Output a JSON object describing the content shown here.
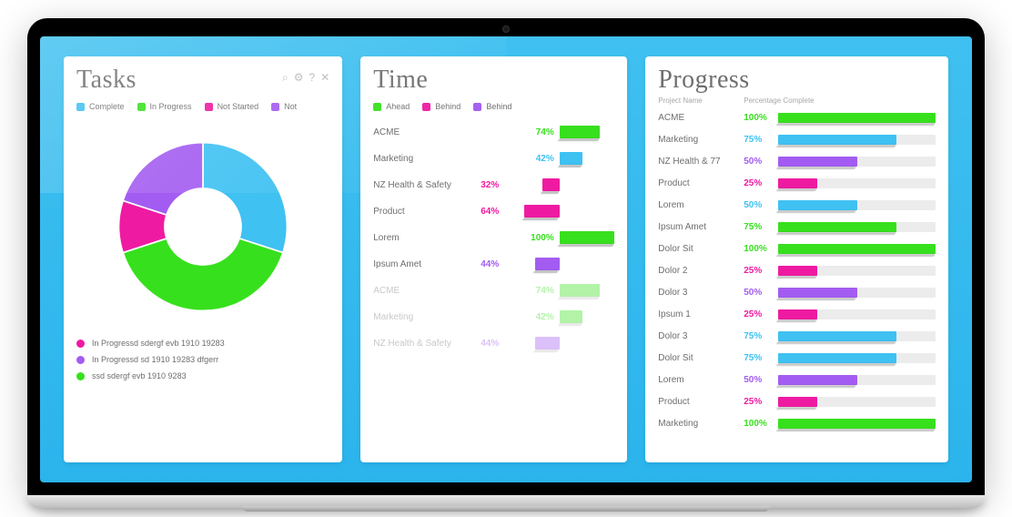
{
  "colors": {
    "blue": "#3fc1f2",
    "green": "#37e01d",
    "magenta": "#ef1aa2",
    "purple": "#a35cf1",
    "grey": "#9a9a9a"
  },
  "panels": {
    "tasks": {
      "title": "Tasks",
      "legend": [
        {
          "label": "Complete",
          "color": "blue"
        },
        {
          "label": "In Progress",
          "color": "green"
        },
        {
          "label": "Not Started",
          "color": "magenta"
        },
        {
          "label": "Not",
          "color": "purple"
        }
      ],
      "notes": [
        {
          "color": "magenta",
          "text": "In Progressd sdergf  evb  1910   19283"
        },
        {
          "color": "purple",
          "text": "In Progressd sd 1910   19283 dfgerr"
        },
        {
          "color": "green",
          "text": "ssd sdergf  evb 1910 9283"
        }
      ]
    },
    "time": {
      "title": "Time",
      "legend": [
        {
          "label": "Ahead",
          "color": "green"
        },
        {
          "label": "Behind",
          "color": "magenta"
        },
        {
          "label": "Behind",
          "color": "purple"
        }
      ]
    },
    "progress": {
      "title": "Progress",
      "header": {
        "col1": "Project  Name",
        "col2": "Percentage Complete"
      }
    }
  },
  "chart_data": [
    {
      "id": "tasks_donut",
      "type": "pie",
      "title": "Tasks",
      "series": [
        {
          "name": "Complete",
          "value": 30,
          "color": "blue"
        },
        {
          "name": "In Progress",
          "value": 40,
          "color": "green"
        },
        {
          "name": "Not Started",
          "value": 10,
          "color": "magenta"
        },
        {
          "name": "Not",
          "value": 20,
          "color": "purple"
        }
      ],
      "donut": true
    },
    {
      "id": "time_bars",
      "type": "bar",
      "title": "Time",
      "orientation": "horizontal",
      "xlabel": "",
      "ylabel": "",
      "baseline": 0,
      "series": [
        {
          "name": "ACME",
          "value": 74,
          "status": "Ahead",
          "color": "green",
          "faded": false
        },
        {
          "name": "Marketing",
          "value": 42,
          "status": "Ahead",
          "color": "blue",
          "faded": false
        },
        {
          "name": "NZ Health & Safety",
          "value": -32,
          "status": "Behind",
          "color": "magenta",
          "faded": false
        },
        {
          "name": "Product",
          "value": -64,
          "status": "Behind",
          "color": "magenta",
          "faded": false
        },
        {
          "name": "Lorem",
          "value": 100,
          "status": "Ahead",
          "color": "green",
          "faded": false
        },
        {
          "name": "Ipsum Amet",
          "value": -44,
          "status": "Behind",
          "color": "purple",
          "faded": false
        },
        {
          "name": "ACME",
          "value": 74,
          "status": "Ahead",
          "color": "green",
          "faded": true
        },
        {
          "name": "Marketing",
          "value": 42,
          "status": "Ahead",
          "color": "green",
          "faded": true
        },
        {
          "name": "NZ Health & Safety",
          "value": -44,
          "status": "Behind",
          "color": "purple",
          "faded": true
        }
      ]
    },
    {
      "id": "progress_bars",
      "type": "bar",
      "title": "Progress",
      "orientation": "horizontal",
      "xlabel": "Percentage Complete",
      "ylabel": "Project Name",
      "ylim": [
        0,
        100
      ],
      "series": [
        {
          "name": "ACME",
          "value": 100,
          "color": "green"
        },
        {
          "name": "Marketing",
          "value": 75,
          "color": "blue"
        },
        {
          "name": "NZ Health & 77",
          "value": 50,
          "color": "purple"
        },
        {
          "name": "Product",
          "value": 25,
          "color": "magenta"
        },
        {
          "name": "Lorem",
          "value": 50,
          "color": "blue"
        },
        {
          "name": "Ipsum Amet",
          "value": 75,
          "color": "green"
        },
        {
          "name": "Dolor Sit",
          "value": 100,
          "color": "green"
        },
        {
          "name": "Dolor 2",
          "value": 25,
          "color": "magenta"
        },
        {
          "name": "Dolor 3",
          "value": 50,
          "color": "purple"
        },
        {
          "name": "Ipsum 1",
          "value": 25,
          "color": "magenta"
        },
        {
          "name": "Dolor 3",
          "value": 75,
          "color": "blue"
        },
        {
          "name": "Dolor Sit",
          "value": 75,
          "color": "blue"
        },
        {
          "name": "Lorem",
          "value": 50,
          "color": "purple"
        },
        {
          "name": "Product",
          "value": 25,
          "color": "magenta"
        },
        {
          "name": "Marketing",
          "value": 100,
          "color": "green"
        }
      ]
    }
  ]
}
